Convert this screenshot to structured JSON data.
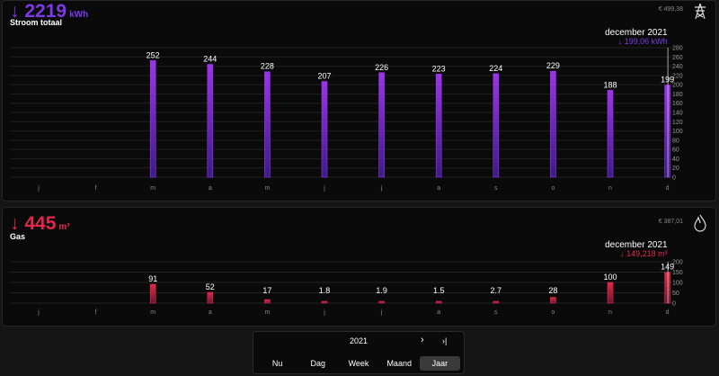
{
  "stroom": {
    "total": "↓ 2219",
    "unit": "kWh",
    "label": "Stroom totaal",
    "cost": "€ 499,38",
    "tooltip": {
      "period": "december 2021",
      "value": "↓ 199,06 kWh"
    },
    "color": "#7b2fd6",
    "icon": "power-pylon-icon"
  },
  "gas": {
    "total": "↓ 445",
    "unit": "m³",
    "label": "Gas",
    "cost": "€ 387,01",
    "tooltip": {
      "period": "december 2021",
      "value": "↓ 149,218 m³"
    },
    "color": "#e0284a",
    "icon": "flame-icon"
  },
  "navigation": {
    "year": "2021",
    "next_icon": "chevron-right-icon",
    "last_icon": "skip-to-end-icon",
    "tabs": [
      "Nu",
      "Dag",
      "Week",
      "Maand",
      "Jaar"
    ],
    "active_tab": "Jaar"
  },
  "chart_data": [
    {
      "type": "bar",
      "categories": [
        "j",
        "f",
        "m",
        "a",
        "m",
        "j",
        "j",
        "a",
        "s",
        "o",
        "n",
        "d"
      ],
      "values": [
        null,
        null,
        252,
        244,
        228,
        207,
        226,
        223,
        224,
        229,
        188,
        199
      ],
      "labels": [
        "",
        "",
        "252",
        "244",
        "228",
        "207",
        "226",
        "223",
        "224",
        "229",
        "188",
        "199"
      ],
      "yticks": [
        "280",
        "260",
        "240",
        "220",
        "200",
        "180",
        "160",
        "140",
        "120",
        "100",
        "80",
        "60",
        "40",
        "20",
        "0"
      ],
      "ylim": [
        0,
        280
      ]
    },
    {
      "type": "bar",
      "categories": [
        "j",
        "f",
        "m",
        "a",
        "m",
        "j",
        "j",
        "a",
        "s",
        "o",
        "n",
        "d"
      ],
      "values": [
        null,
        null,
        91,
        52,
        17,
        1.8,
        1.9,
        1.5,
        2.7,
        28,
        100,
        149
      ],
      "labels": [
        "",
        "",
        "91",
        "52",
        "17",
        "1.8",
        "1.9",
        "1.5",
        "2.7",
        "28",
        "100",
        "149"
      ],
      "yticks": [
        "200",
        "150",
        "100",
        "50",
        "0"
      ],
      "ylim": [
        0,
        200
      ]
    }
  ]
}
